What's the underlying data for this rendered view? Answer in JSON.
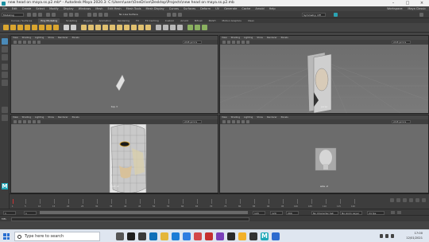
{
  "window": {
    "title": "new head on maya.ss.p2.mb* - Autodesk Maya 2020.3: C:\\Users\\user\\OneDrive\\Desktop\\Projects\\new head on maya.ss.p2.mb"
  },
  "menubar": {
    "items": [
      "File",
      "Edit",
      "Create",
      "Select",
      "Modify",
      "Display",
      "Windows",
      "Mesh",
      "Edit Mesh",
      "Mesh Tools",
      "Mesh Display",
      "Curves",
      "Surfaces",
      "Deform",
      "UV",
      "Generate",
      "Cache",
      "Arnold",
      "Help"
    ],
    "right": [
      "Workspace:",
      "Maya Classic"
    ]
  },
  "statusline": {
    "mode": "Modeling",
    "search_placeholder": "Symmetry: Off",
    "no_live": "No Live Surface"
  },
  "shelf": {
    "tabs": [
      "Curves / Surfaces",
      "Poly Modeling",
      "Sculpting",
      "Rigging",
      "Animation",
      "Rendering",
      "FX",
      "FX Caching",
      "Custom",
      "Arnold",
      "Bifrost",
      "MASH",
      "Motion Graphics",
      "XGen"
    ],
    "active_tab": "Poly Modeling"
  },
  "viewport_menu": [
    "View",
    "Shading",
    "Lighting",
    "Show",
    "Renderer",
    "Panels"
  ],
  "viewports": [
    {
      "id": "top",
      "label": "top -Y",
      "camera": "sRGB gamma"
    },
    {
      "id": "persp",
      "label": "persp",
      "camera": "sRGB gamma"
    },
    {
      "id": "front",
      "label": "front -Z",
      "camera": "sRGB gamma"
    },
    {
      "id": "side",
      "label": "side -X",
      "camera": "sRGB gamma"
    }
  ],
  "timeslider": {
    "ticks": [
      "1",
      "5",
      "10",
      "15",
      "20",
      "25",
      "30",
      "35",
      "40",
      "45",
      "50",
      "55",
      "60",
      "65",
      "70",
      "75",
      "80",
      "85",
      "90",
      "95",
      "100",
      "105",
      "110",
      "115",
      "120"
    ],
    "current_frame": "1"
  },
  "range": {
    "start": "1",
    "inner_start": "1",
    "inner_end": "120",
    "end": "120",
    "end2": "200",
    "character_set": "No Character Set",
    "anim_layer": "No Anim Layer",
    "fps": "24 fps"
  },
  "cmdline": {
    "label": "MEL"
  },
  "taskbar": {
    "search_placeholder": "Type here to search",
    "time": "17:00",
    "date": "12/01/2021"
  },
  "colors": {
    "accent": "#1fa8b8",
    "taskbar": "#dfe6f0",
    "viewport_bg": "#6e6e6e"
  }
}
